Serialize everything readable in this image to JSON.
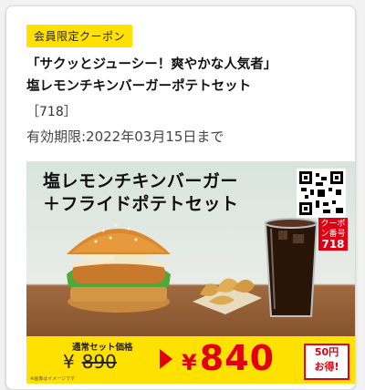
{
  "coupon": {
    "tag": "会員限定クーポン",
    "headline_line1": "「サクッとジューシー！爽やかな人気者」",
    "headline_line2": "塩レモンチキンバーガーポテトセット",
    "code": "［718］",
    "expiry": "有効期限:2022年03月15日まで"
  },
  "image": {
    "title_line1": "塩レモンチキンバーガー",
    "title_line2": "＋フライドポテトセット",
    "badge_label": "クーポン番号",
    "badge_number": "718",
    "regular_label": "通常セット価格",
    "regular_currency": "¥",
    "regular_price": "890",
    "sale_currency": "¥",
    "sale_price": "840",
    "save_line1": "50円",
    "save_line2": "お得!",
    "footnote": "※画像はイメージです"
  },
  "colors": {
    "accent_yellow": "#ffe100",
    "accent_red": "#e00012"
  }
}
